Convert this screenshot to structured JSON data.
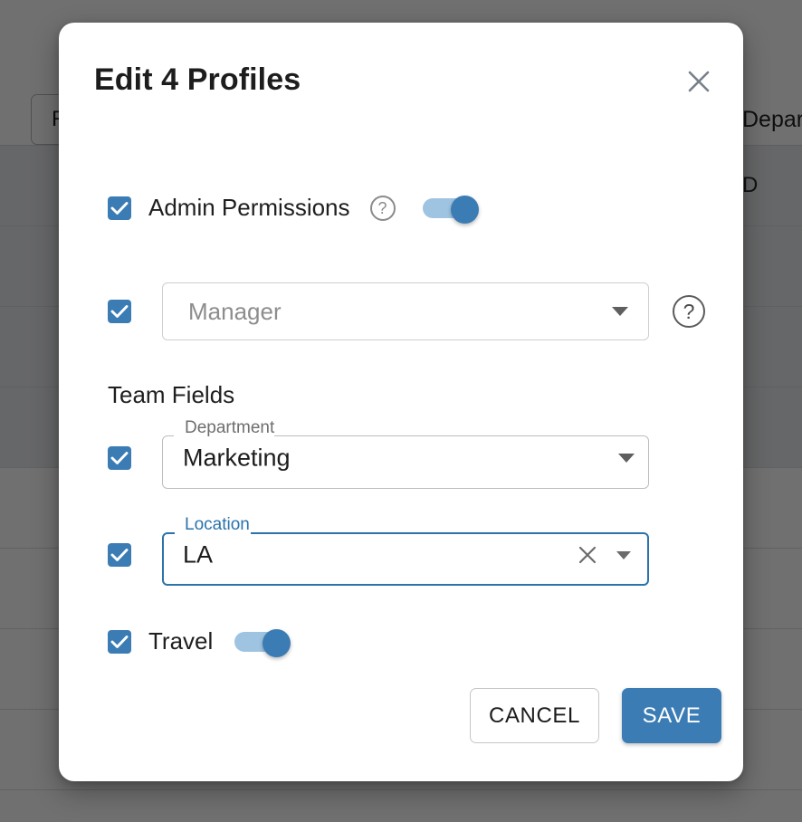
{
  "background": {
    "search_value": "R",
    "column_header_department": "Department",
    "cell_department": "D",
    "rows_selected_count": 4,
    "rows_total": 8
  },
  "modal": {
    "title": "Edit 4 Profiles",
    "close_label": "×",
    "section_title": "Team Fields",
    "admin": {
      "label": "Admin Permissions",
      "help": "?",
      "checkbox_checked": true,
      "toggle_on": true
    },
    "manager": {
      "placeholder": "Manager",
      "help": "?",
      "checkbox_checked": true
    },
    "department": {
      "label": "Department",
      "value": "Marketing",
      "checkbox_checked": true
    },
    "location": {
      "label": "Location",
      "value": "LA",
      "checkbox_checked": true,
      "focused": true
    },
    "travel": {
      "label": "Travel",
      "checkbox_checked": true,
      "toggle_on": true
    },
    "footer": {
      "cancel_label": "CANCEL",
      "save_label": "SAVE"
    }
  },
  "colors": {
    "accent": "#3b7cb5",
    "focus_border": "#2b73ab",
    "toggle_track": "#9ec4e2",
    "muted_text": "#8d8d8d",
    "scrim": "rgba(0,0,0,0.56)"
  }
}
